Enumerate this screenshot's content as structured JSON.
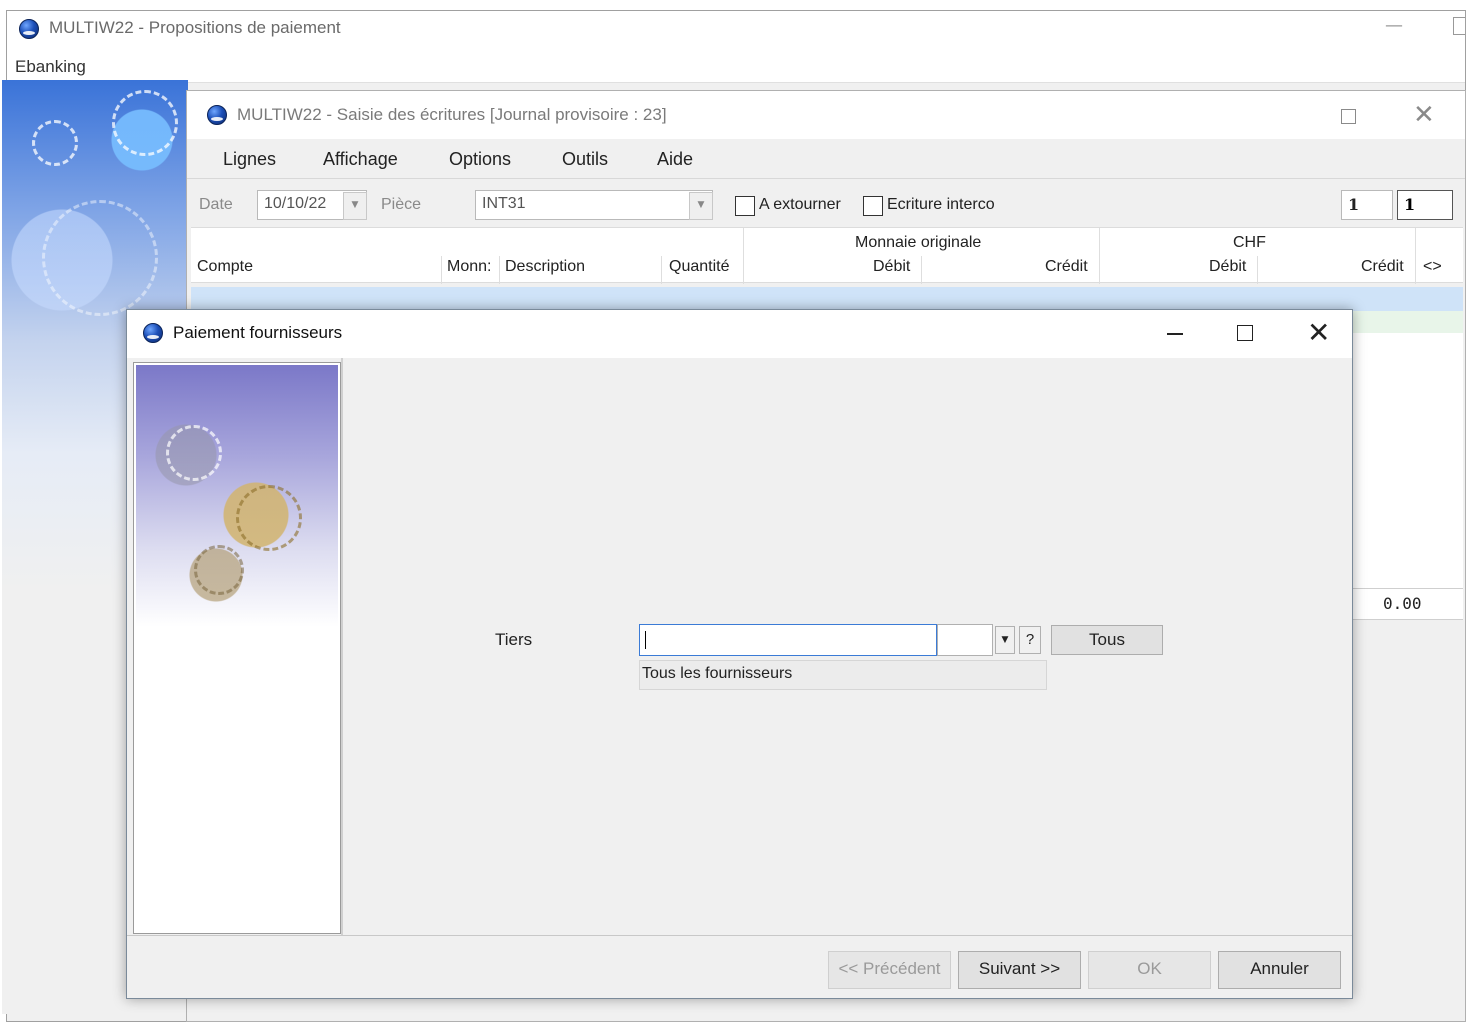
{
  "outer_window": {
    "title": "MULTIW22 - Propositions de paiement",
    "menu": [
      "Ebanking"
    ],
    "min_glyph": "—"
  },
  "journal_window": {
    "title": "MULTIW22 - Saisie des écritures [Journal provisoire : 23]",
    "menu": [
      "Lignes",
      "Affichage",
      "Options",
      "Outils",
      "Aide"
    ],
    "toolbar": {
      "date_label": "Date",
      "date_value": "10/10/22",
      "piece_label": "Pièce",
      "piece_value": "INT31",
      "extourner_label": "A extourner",
      "interco_label": "Ecriture interco",
      "counter1": "1",
      "counter2": "1"
    },
    "grid": {
      "group_original": "Monnaie originale",
      "group_chf": "CHF",
      "columns": [
        "Compte",
        "Monn:",
        "Description",
        "Quantité",
        "Débit",
        "Crédit",
        "Débit",
        "Crédit",
        "<>"
      ],
      "total": "0.00"
    },
    "close_glyph": "✕"
  },
  "dialog": {
    "title": "Paiement fournisseurs",
    "close_glyph": "✕",
    "tiers_label": "Tiers",
    "tiers_value": "",
    "dropdown_glyph": "▼",
    "help_label": "?",
    "tous_button": "Tous",
    "tiers_description": "Tous les fournisseurs",
    "buttons": {
      "previous": "<< Précédent",
      "next": "Suivant >>",
      "ok": "OK",
      "cancel": "Annuler"
    }
  },
  "colors": {
    "focus_border": "#3b7bd6",
    "row_selected": "#cfe3f8",
    "row_alt": "#e8f5e9"
  }
}
